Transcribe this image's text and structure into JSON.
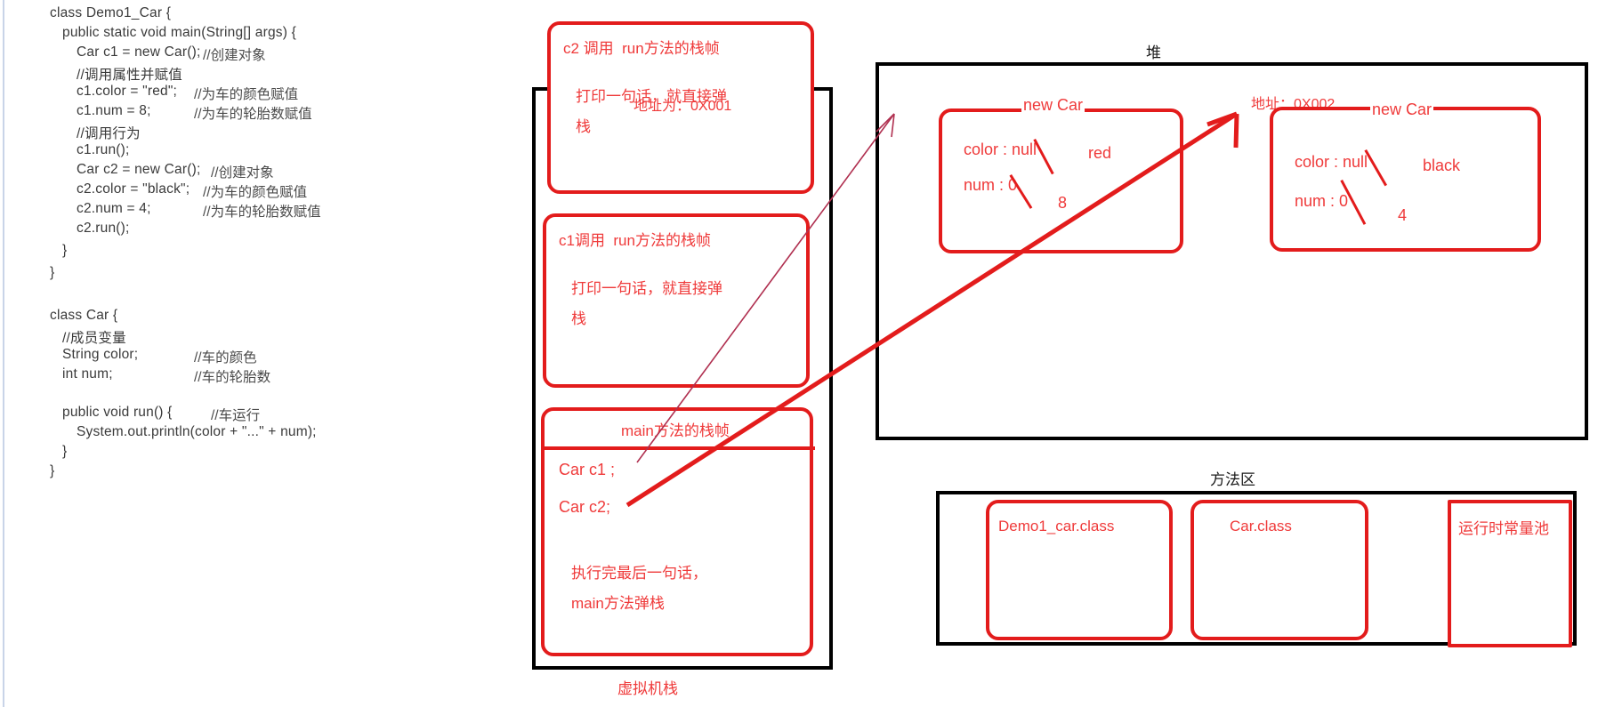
{
  "diagram": {
    "title": "JVM memory model with Java source code",
    "colors": {
      "red": "#e31c1c",
      "red_text": "#ef3a3a",
      "black": "#000000",
      "code_text": "#3a3a3a"
    }
  },
  "code": {
    "lines": [
      {
        "text": "class Demo1_Car {",
        "indent": 0
      },
      {
        "text": "public static void main(String[] args) {",
        "indent": 1
      },
      {
        "text": "Car c1 = new Car();",
        "indent": 2,
        "comment": "//创建对象"
      },
      {
        "text": "//调用属性并赋值",
        "indent": 2
      },
      {
        "text": "c1.color = \"red\";",
        "indent": 2,
        "comment": "//为车的颜色赋值"
      },
      {
        "text": "c1.num = 8;",
        "indent": 2,
        "comment": "//为车的轮胎数赋值"
      },
      {
        "text": "//调用行为",
        "indent": 2
      },
      {
        "text": "c1.run();",
        "indent": 2
      },
      {
        "text": "Car c2 = new Car();",
        "indent": 2,
        "comment": "//创建对象"
      },
      {
        "text": "c2.color = \"black\";",
        "indent": 2,
        "comment": "//为车的颜色赋值"
      },
      {
        "text": "c2.num = 4;",
        "indent": 2,
        "comment": "//为车的轮胎数赋值"
      },
      {
        "text": "c2.run();",
        "indent": 2
      },
      {
        "text": "}",
        "indent": 1
      },
      {
        "text": "}",
        "indent": 0
      },
      {
        "text": "",
        "indent": 0
      },
      {
        "text": "class Car {",
        "indent": 0
      },
      {
        "text": "//成员变量",
        "indent": 1
      },
      {
        "text": "String color;",
        "indent": 1,
        "comment": "//车的颜色"
      },
      {
        "text": "int num;",
        "indent": 1,
        "comment": "//车的轮胎数"
      },
      {
        "text": "",
        "indent": 0
      },
      {
        "text": "public void run() {",
        "indent": 1,
        "comment": "//车运行"
      },
      {
        "text": "System.out.println(color + \"...\" + num);",
        "indent": 2
      },
      {
        "text": "}",
        "indent": 1
      },
      {
        "text": "}",
        "indent": 0
      }
    ]
  },
  "stack": {
    "label": "虚拟机栈",
    "frames": [
      {
        "title": "c2 调用  run方法的栈帧",
        "body": [
          "打印一句话，就直接弹",
          "栈"
        ]
      },
      {
        "title": "c1调用  run方法的栈帧",
        "body": [
          "打印一句话，就直接弹",
          "栈"
        ]
      },
      {
        "title": "main方法的栈帧",
        "vars": [
          "Car c1 ;",
          "Car c2;"
        ],
        "body": [
          "执行完最后一句话，",
          "main方法弹栈"
        ]
      }
    ]
  },
  "heap": {
    "label": "堆",
    "objects": [
      {
        "address_label": "地址为：0X001",
        "name": "new Car",
        "fields": [
          {
            "key": "color : null",
            "new_value": "red"
          },
          {
            "key": "num : 0",
            "new_value": "8"
          }
        ]
      },
      {
        "address_label": "地址：0X002",
        "name": "new Car",
        "fields": [
          {
            "key": "color : null",
            "new_value": "black"
          },
          {
            "key": "num : 0",
            "new_value": "4"
          }
        ]
      }
    ]
  },
  "method_area": {
    "label": "方法区",
    "items": [
      {
        "name": "Demo1_car.class"
      },
      {
        "name": "Car.class"
      },
      {
        "name": "运行时常量池"
      }
    ]
  }
}
